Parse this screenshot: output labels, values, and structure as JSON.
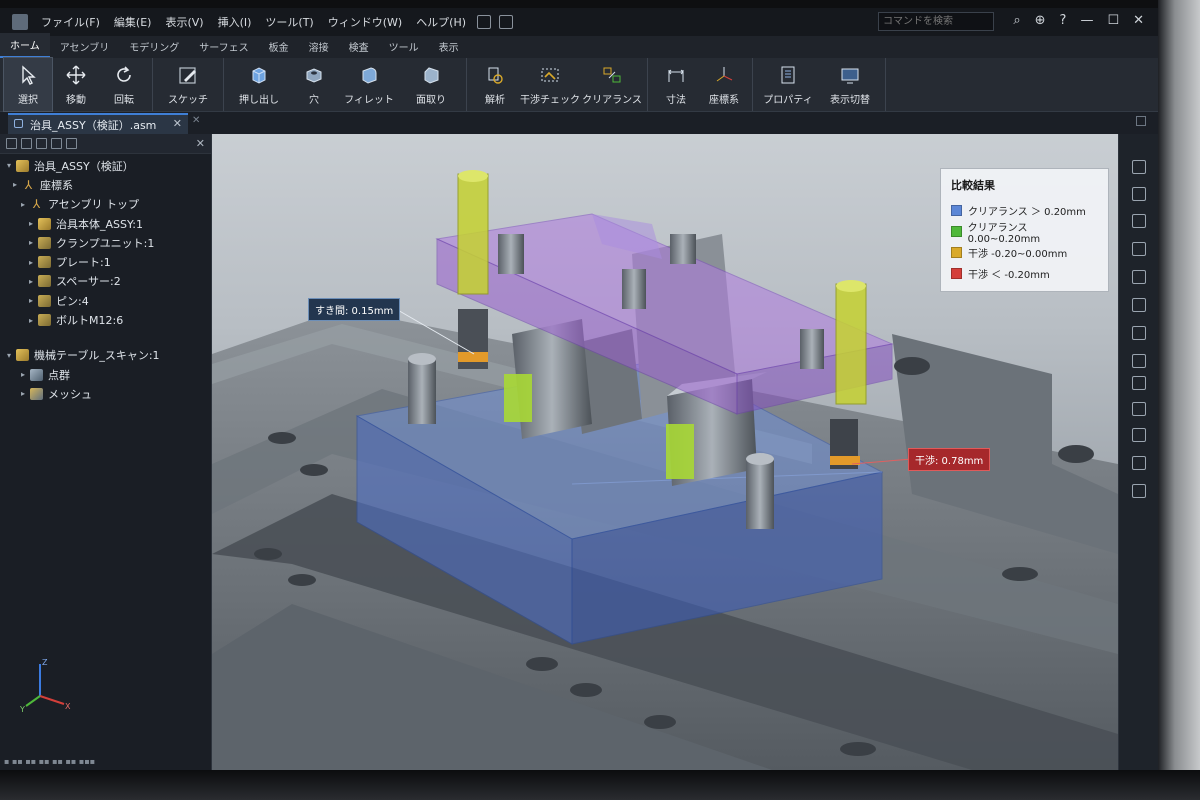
{
  "menubar": {
    "items": [
      "ファイル(F)",
      "編集(E)",
      "表示(V)",
      "挿入(I)",
      "ツール(T)",
      "ウィンドウ(W)",
      "ヘルプ(H)"
    ],
    "command_search_placeholder": "コマンドを検索"
  },
  "ribbon_tabs": [
    "ホーム",
    "アセンブリ",
    "モデリング",
    "サーフェス",
    "板金",
    "溶接",
    "検査",
    "ツール",
    "表示"
  ],
  "ribbon": {
    "select": "選択",
    "move": "移動",
    "rotate": "回転",
    "sketch": "スケッチ",
    "extrude": "押し出し",
    "hole": "穴",
    "fillet": "フィレット",
    "chamfer": "面取り",
    "analysis": "解析",
    "interference_check": "干渉チェック",
    "clearance": "クリアランス",
    "dimension": "寸法",
    "coordinate": "座標系",
    "properties": "プロパティ",
    "display_toggle": "表示切替"
  },
  "document_tab": {
    "title": "治具_ASSY（検証）.asm"
  },
  "tree": {
    "root": "治具_ASSY（検証）",
    "coord": "座標系",
    "assembly_top": "アセンブリ トップ",
    "items": [
      "治具本体_ASSY:1",
      "クランプユニット:1",
      "プレート:1",
      "スペーサー:2",
      "ピン:4",
      "ボルトM12:6"
    ],
    "scan": "機械テーブル_スキャン:1",
    "scan_children": [
      "点群",
      "メッシュ"
    ]
  },
  "axes": {
    "x": "X",
    "y": "Y",
    "z": "Z"
  },
  "legend": {
    "title": "比較結果",
    "rows": [
      {
        "label": "クリアランス ＞ 0.20mm",
        "color": "#5b86d6"
      },
      {
        "label": "クリアランス 0.00~0.20mm",
        "color": "#4fb83a"
      },
      {
        "label": "干渉 -0.20~0.00mm",
        "color": "#d9a92a"
      },
      {
        "label": "干渉 ＜ -0.20mm",
        "color": "#d43f3a"
      }
    ]
  },
  "callouts": {
    "clearance": "すき間: 0.15mm",
    "interference": "干渉: 0.78mm"
  }
}
